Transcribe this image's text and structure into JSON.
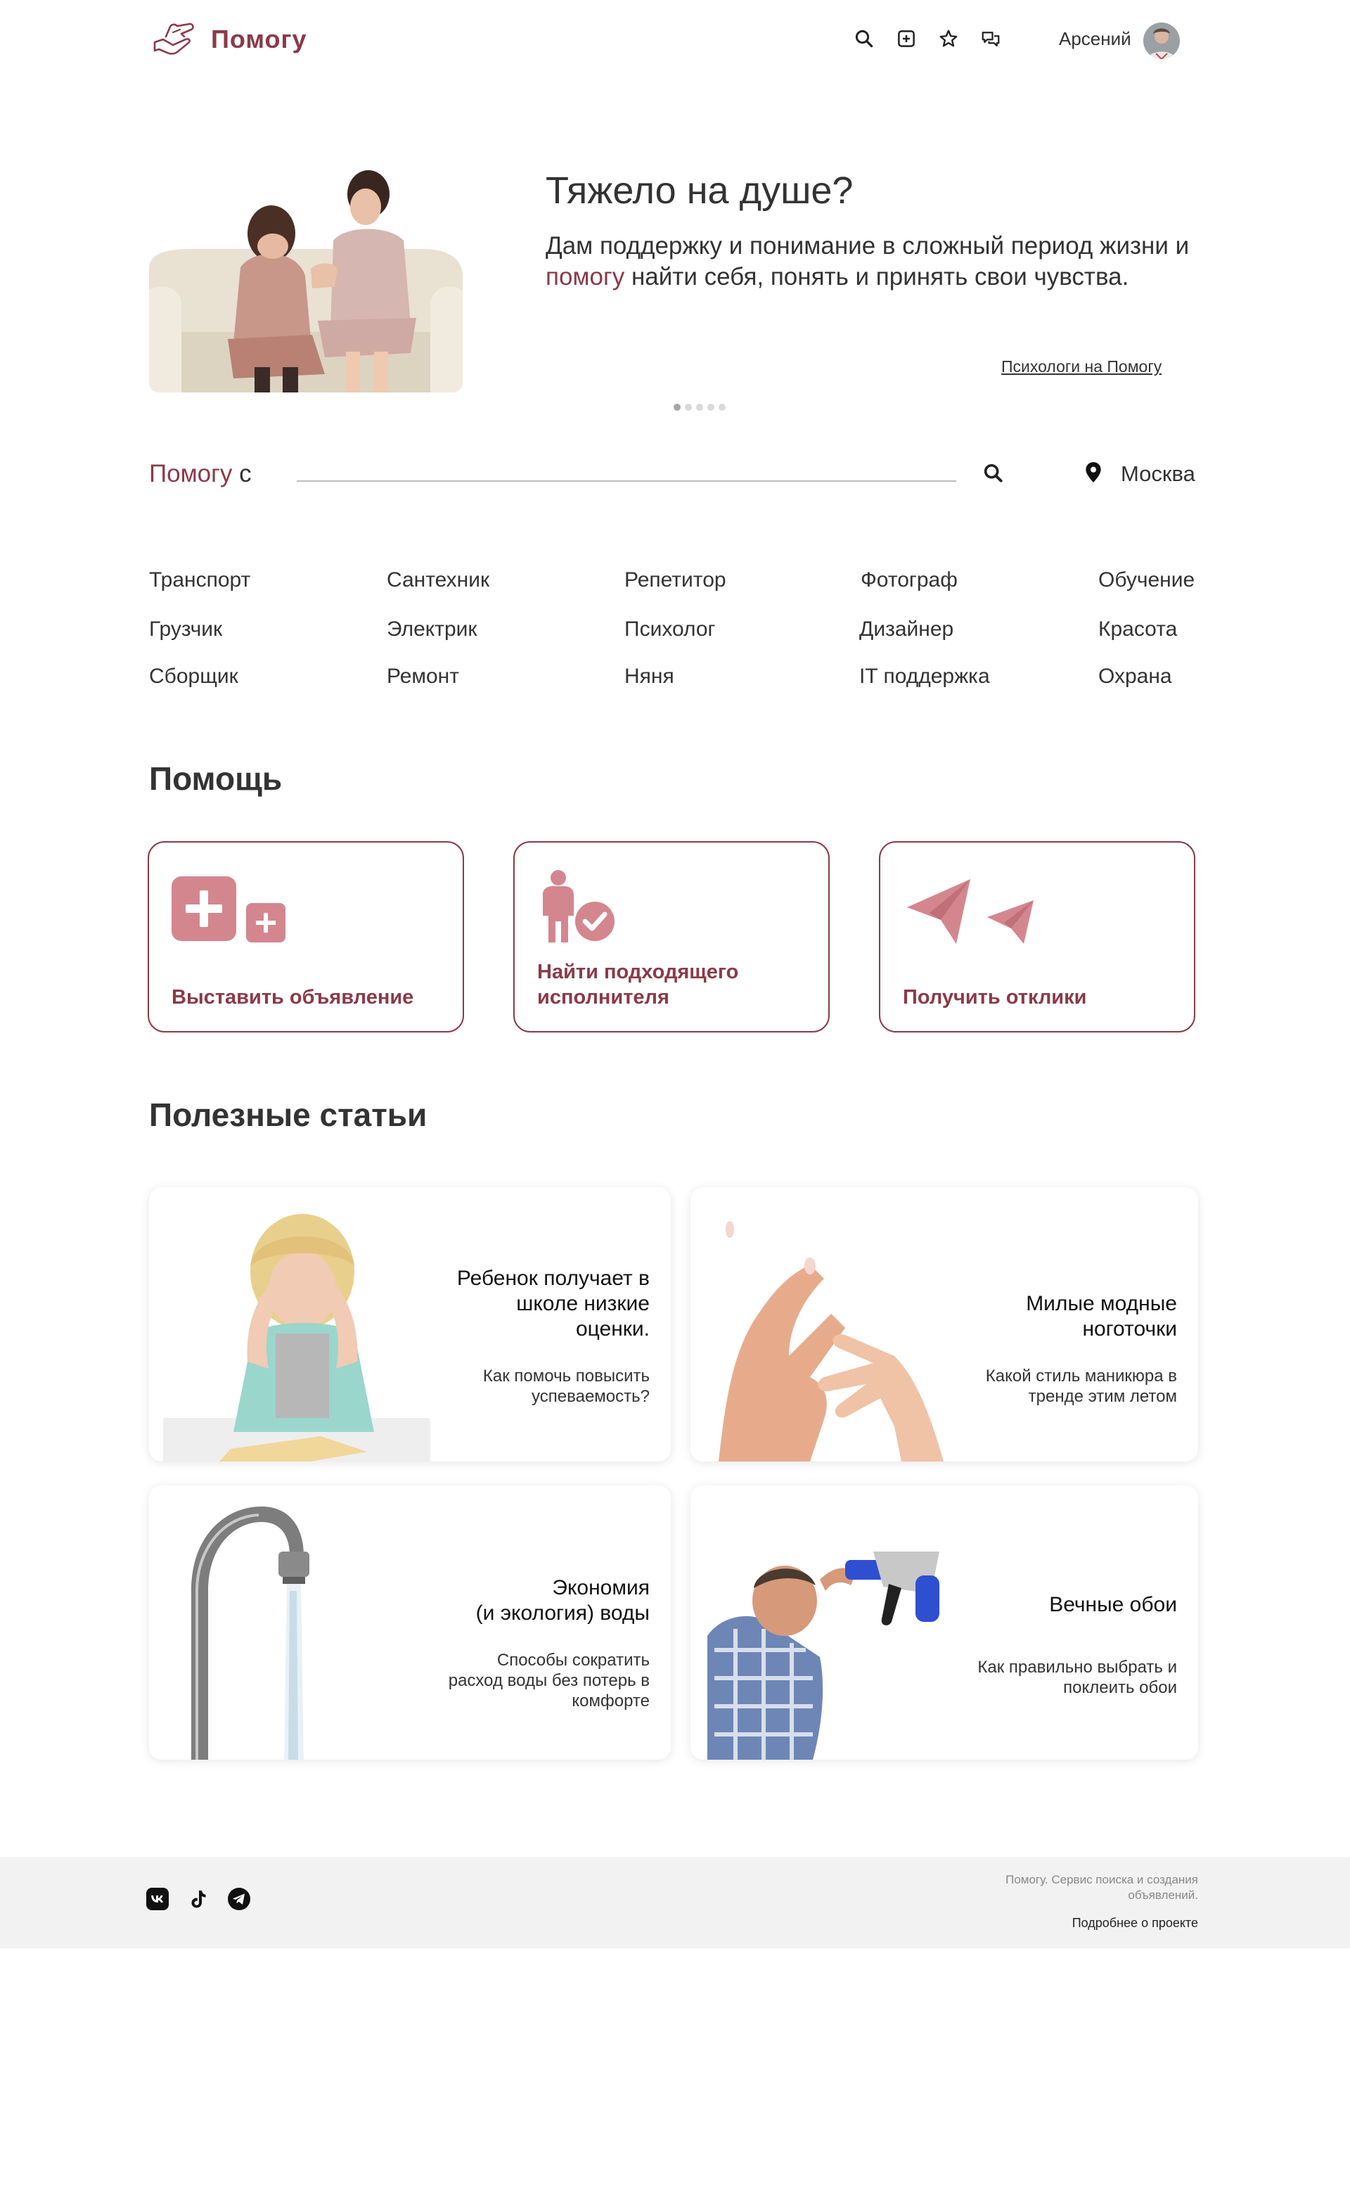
{
  "header": {
    "brand": "Помогу",
    "user_name": "Арсений",
    "icons": [
      "search-icon",
      "add-square-icon",
      "star-icon",
      "chat-icon"
    ]
  },
  "hero": {
    "title": "Тяжело на душе?",
    "text_before": "Дам поддержку и понимание в сложный период жизни и ",
    "text_highlight": "помогу",
    "text_after": " найти себя, понять и принять свои чувства.",
    "link": "Психологи на Помогу",
    "slides_total": 5,
    "slide_active": 1
  },
  "search": {
    "brand": "Помогу",
    "suffix": "с",
    "city": "Москва"
  },
  "categories": [
    [
      "Транспорт",
      "Грузчик",
      "Сборщик"
    ],
    [
      "Сантехник",
      "Электрик",
      "Ремонт"
    ],
    [
      "Репетитор",
      "Психолог",
      "Няня"
    ],
    [
      "Фотограф",
      "Дизайнер",
      "IT поддержка"
    ],
    [
      "Обучение",
      "Красота",
      "Охрана"
    ]
  ],
  "help": {
    "title": "Помощь",
    "cards": [
      {
        "label": "Выставить объявление",
        "icon": "add-listing-icon"
      },
      {
        "label_line1": "Найти подходящего",
        "label_line2": "исполнителя",
        "icon": "find-person-icon"
      },
      {
        "label": "Получить отклики",
        "icon": "paper-plane-icon"
      }
    ]
  },
  "articles": {
    "title": "Полезные статьи",
    "items": [
      {
        "title_lines": [
          "Ребенок получает в",
          "школе низкие",
          "оценки."
        ],
        "subtitle_lines": [
          "Как помочь повысить",
          "успеваемость?"
        ]
      },
      {
        "title_lines": [
          "Милые модные",
          "ноготочки"
        ],
        "subtitle_lines": [
          "Какой стиль маникюра в",
          "тренде этим летом"
        ]
      },
      {
        "title_lines": [
          "Экономия",
          "(и экология) воды"
        ],
        "subtitle_lines": [
          "Способы сократить",
          "расход воды без потерь в",
          "комфорте"
        ]
      },
      {
        "title_lines": [
          "Вечные обои"
        ],
        "subtitle_lines": [
          "Как правильно выбрать и",
          "поклеить обои"
        ]
      }
    ]
  },
  "footer": {
    "social": [
      "vk-icon",
      "tiktok-icon",
      "telegram-icon"
    ],
    "description_line1": "Помогу. Сервис поиска и создания",
    "description_line2": "объявлений.",
    "more_link": "Подробнее о проекте"
  },
  "colors": {
    "accent": "#8b3a48",
    "accent_light": "#d4868f",
    "footer_bg": "#f2f2f2"
  }
}
